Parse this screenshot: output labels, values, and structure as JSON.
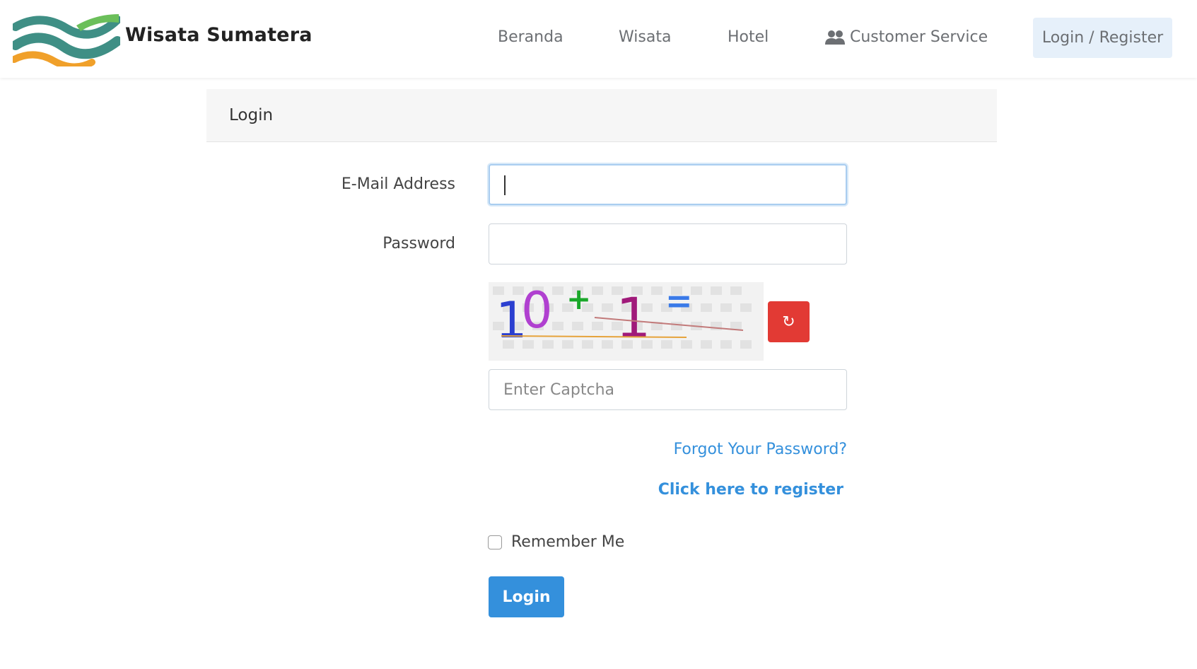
{
  "header": {
    "brand_name": "Wisata Sumatera",
    "nav": [
      {
        "label": "Beranda"
      },
      {
        "label": "Wisata"
      },
      {
        "label": "Hotel"
      },
      {
        "label": "Customer Service",
        "icon": "users-icon"
      },
      {
        "label": "Login / Register"
      }
    ]
  },
  "card": {
    "title": "Login"
  },
  "form": {
    "email_label": "E-Mail Address",
    "email_value": "",
    "password_label": "Password",
    "password_value": "",
    "captcha_text": "10+1=",
    "refresh_icon": "↻",
    "captcha_placeholder": "Enter Captcha",
    "forgot_password": "Forgot Your Password?",
    "register_link": "Click here to register",
    "remember_me": "Remember Me",
    "remember_checked": false,
    "login_button": "Login"
  },
  "colors": {
    "primary": "#3490dc",
    "refresh": "#e23a34",
    "logo_teal": "#3f8f85",
    "logo_green": "#6bbf5a",
    "logo_orange": "#f0a02a"
  }
}
